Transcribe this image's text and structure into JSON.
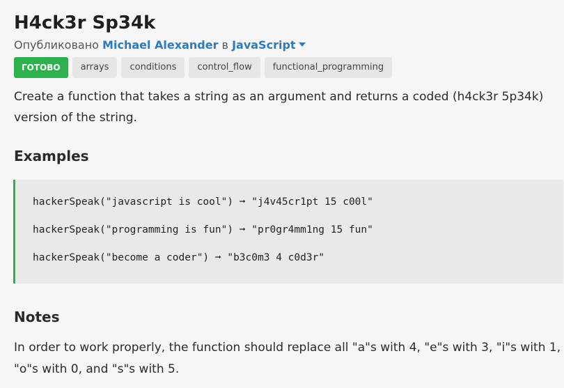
{
  "challenge": {
    "title": "H4ck3r Sp34k",
    "published_prefix": "Опубликовано",
    "author": "Michael Alexander",
    "in_word": "в",
    "language": "JavaScript",
    "status_tag": "ГОТОВО",
    "tags": [
      "arrays",
      "conditions",
      "control_flow",
      "functional_programming"
    ],
    "description": "Create a function that takes a string as an argument and returns a coded (h4ck3r 5p34k) version of the string."
  },
  "examples": {
    "heading": "Examples",
    "lines": [
      "hackerSpeak(\"javascript is cool\") ➞ \"j4v45cr1pt 15 c00l\"",
      "hackerSpeak(\"programming is fun\") ➞ \"pr0gr4mm1ng 15 fun\"",
      "hackerSpeak(\"become a coder\") ➞ \"b3c0m3 4 c0d3r\""
    ]
  },
  "notes": {
    "heading": "Notes",
    "text": "In order to work properly, the function should replace all \"a\"s with 4, \"e\"s with 3, \"i\"s with 1, \"o\"s with 0, and \"s\"s with 5."
  },
  "colors": {
    "accent_green": "#2bb24c",
    "link_blue": "#2c7bbd",
    "code_bg": "#e9e9e9",
    "tag_bg": "#e6e6e6"
  },
  "icons": {
    "language_dropdown": "caret-down-icon"
  }
}
